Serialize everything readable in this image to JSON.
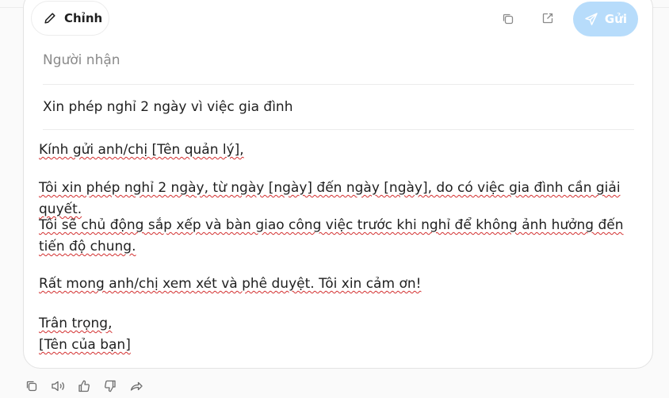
{
  "toolbar": {
    "edit_label": "Chỉnh",
    "send_label": "Gửi",
    "copy_icon": "copy-icon",
    "open_icon": "open-external-icon",
    "send_icon": "paper-plane-icon",
    "edit_icon": "pencil-icon"
  },
  "email": {
    "recipient_placeholder": "Người nhận",
    "subject": "Xin phép nghỉ 2 ngày vì việc gia đình",
    "greeting": "Kính gửi anh/chị [Tên quản lý],",
    "paragraph1": "Tôi xin phép nghỉ 2 ngày, từ ngày [ngày] đến ngày [ngày], do có việc gia đình cần giải quyết.",
    "paragraph2": "Tôi sẽ chủ động sắp xếp và bàn giao công việc trước khi nghỉ để không ảnh hưởng đến tiến độ chung.",
    "paragraph3": "Rất mong anh/chị xem xét và phê duyệt. Tôi xin cảm ơn!",
    "closing": "Trân trọng,",
    "signature": "[Tên của bạn]"
  },
  "bottom_actions": [
    "copy-icon",
    "speaker-icon",
    "thumbs-up-icon",
    "thumbs-down-icon",
    "share-icon"
  ],
  "colors": {
    "send_button": "#b7dcfb",
    "spellcheck_underline": "#d32f2f"
  }
}
